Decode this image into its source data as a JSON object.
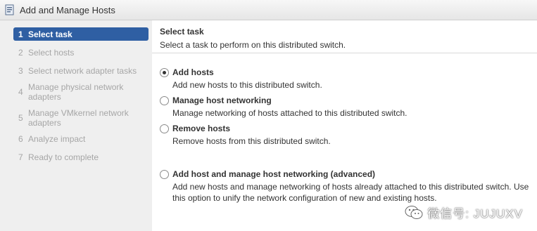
{
  "window": {
    "title": "Add and Manage Hosts",
    "icon": "wizard-icon"
  },
  "sidebar": {
    "steps": [
      {
        "num": "1",
        "label": "Select task",
        "active": true
      },
      {
        "num": "2",
        "label": "Select hosts",
        "active": false
      },
      {
        "num": "3",
        "label": "Select network adapter tasks",
        "active": false
      },
      {
        "num": "4",
        "label": "Manage physical network adapters",
        "active": false
      },
      {
        "num": "5",
        "label": "Manage VMkernel network adapters",
        "active": false
      },
      {
        "num": "6",
        "label": "Analyze impact",
        "active": false
      },
      {
        "num": "7",
        "label": "Ready to complete",
        "active": false
      }
    ]
  },
  "main": {
    "title": "Select task",
    "description": "Select a task to perform on this distributed switch.",
    "options": [
      {
        "label": "Add hosts",
        "description": "Add new hosts to this distributed switch.",
        "selected": true
      },
      {
        "label": "Manage host networking",
        "description": "Manage networking of hosts attached to this distributed switch.",
        "selected": false
      },
      {
        "label": "Remove hosts",
        "description": "Remove hosts from this distributed switch.",
        "selected": false
      },
      {
        "label": "Add host and manage host networking (advanced)",
        "description": "Add new hosts and manage networking of hosts already attached to this distributed switch. Use this option to unify the network configuration of new and existing hosts.",
        "selected": false
      }
    ]
  },
  "watermark": {
    "text": "微信号: JUJUXV",
    "icon": "wechat-icon"
  },
  "colors": {
    "active_step_bg": "#2f5fa3",
    "sidebar_bg": "#efefef",
    "inactive_step_text": "#a6a6a6"
  }
}
